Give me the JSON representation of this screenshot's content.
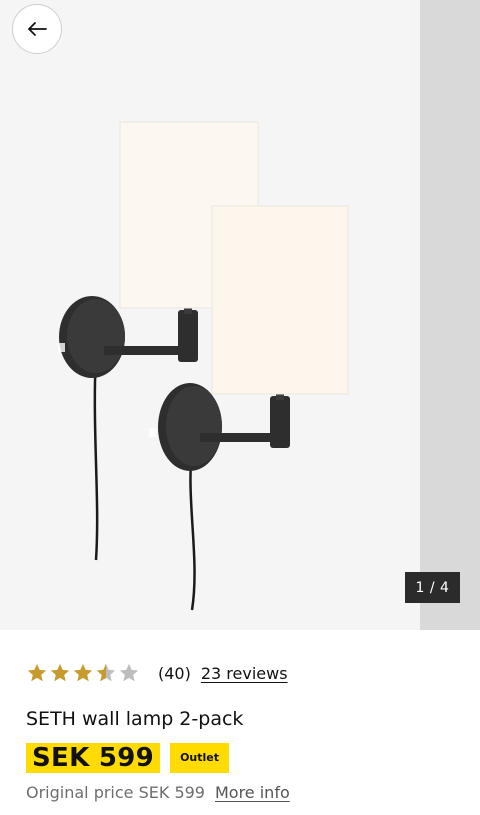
{
  "gallery": {
    "counter": "1 / 4",
    "current_image": 1,
    "total_images": 4
  },
  "product": {
    "rating": 3.5,
    "rating_max": 5,
    "rating_count": "(40)",
    "reviews_link": "23 reviews",
    "name": "SETH wall lamp 2-pack",
    "price": "SEK 599",
    "badge": "Outlet",
    "original_price": "Original price SEK 599",
    "more_info": "More info"
  },
  "colors": {
    "price_highlight": "#ffdb00",
    "star_filled": "#c69a2d",
    "star_empty": "#bdbdbd",
    "counter_bg": "#2b2b2b"
  },
  "icons": {
    "back": "arrow-left-icon",
    "star": "star-icon"
  }
}
